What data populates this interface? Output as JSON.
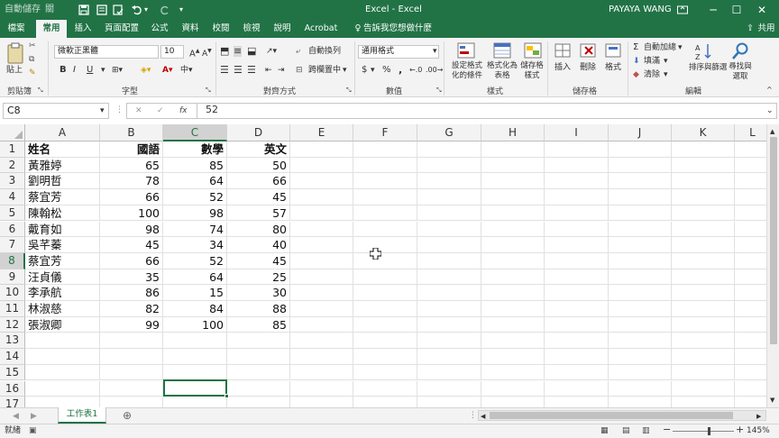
{
  "titlebar": {
    "autosave": "自動儲存",
    "autosave_state": "關",
    "title": "Excel - Excel",
    "user": "PAYAYA WANG",
    "window_buttons": [
      "minimize-icon",
      "maximize-icon",
      "close-icon"
    ]
  },
  "tabs": [
    "檔案",
    "常用",
    "插入",
    "頁面配置",
    "公式",
    "資料",
    "校閱",
    "檢視",
    "說明",
    "Acrobat"
  ],
  "active_tab": "常用",
  "tell_me": "告訴我您想做什麼",
  "share": "共用",
  "ribbon": {
    "clipboard": {
      "paste": "貼上",
      "label": "剪貼簿"
    },
    "font": {
      "name": "微軟正黑體",
      "size": "10",
      "label": "字型",
      "bold": "B",
      "italic": "I",
      "underline": "U"
    },
    "alignment": {
      "wrap": "自動換列",
      "merge": "跨欄置中",
      "label": "對齊方式"
    },
    "number": {
      "format": "通用格式",
      "label": "數值",
      "currency": "$",
      "percent": "%",
      "comma": ","
    },
    "styles": {
      "conditional": "設定格式化的條件",
      "table": "格式化為表格",
      "cell_styles": "儲存格樣式",
      "label": "樣式"
    },
    "cells": {
      "insert": "插入",
      "delete": "刪除",
      "format": "格式",
      "label": "儲存格"
    },
    "editing": {
      "autosum": "自動加總",
      "fill": "填滿",
      "clear": "清除",
      "sort": "排序與篩選",
      "find": "尋找與選取",
      "label": "編輯"
    }
  },
  "formula_bar": {
    "name_box": "C8",
    "cancel": "✕",
    "enter": "✓",
    "fx": "fx",
    "value": "52"
  },
  "columns": [
    "A",
    "B",
    "C",
    "D",
    "E",
    "F",
    "G",
    "H",
    "I",
    "J",
    "K",
    "L"
  ],
  "selected_column": "C",
  "selected_row": "8",
  "rows": [
    "1",
    "2",
    "3",
    "4",
    "5",
    "6",
    "7",
    "8",
    "9",
    "10",
    "11",
    "12",
    "13",
    "14",
    "15",
    "16",
    "17"
  ],
  "table": {
    "headers": [
      "姓名",
      "國語",
      "數學",
      "英文"
    ],
    "data": [
      [
        "黃雅婷",
        "65",
        "85",
        "50"
      ],
      [
        "劉明哲",
        "78",
        "64",
        "66"
      ],
      [
        "蔡宜芳",
        "66",
        "52",
        "45"
      ],
      [
        "陳翰松",
        "100",
        "98",
        "57"
      ],
      [
        "戴育如",
        "98",
        "74",
        "80"
      ],
      [
        "吳芊蓁",
        "45",
        "34",
        "40"
      ],
      [
        "蔡宜芳",
        "66",
        "52",
        "45"
      ],
      [
        "汪貞儀",
        "35",
        "64",
        "25"
      ],
      [
        "李承航",
        "86",
        "15",
        "30"
      ],
      [
        "林淑慈",
        "82",
        "84",
        "88"
      ],
      [
        "張淑卿",
        "99",
        "100",
        "85"
      ]
    ]
  },
  "sheet_tab": "工作表1",
  "status": {
    "mode": "就緒",
    "zoom": "145%"
  },
  "colors": {
    "accent": "#217346",
    "ribbon_bg": "#f3f3f3",
    "grid_line": "#e1e1e1"
  }
}
